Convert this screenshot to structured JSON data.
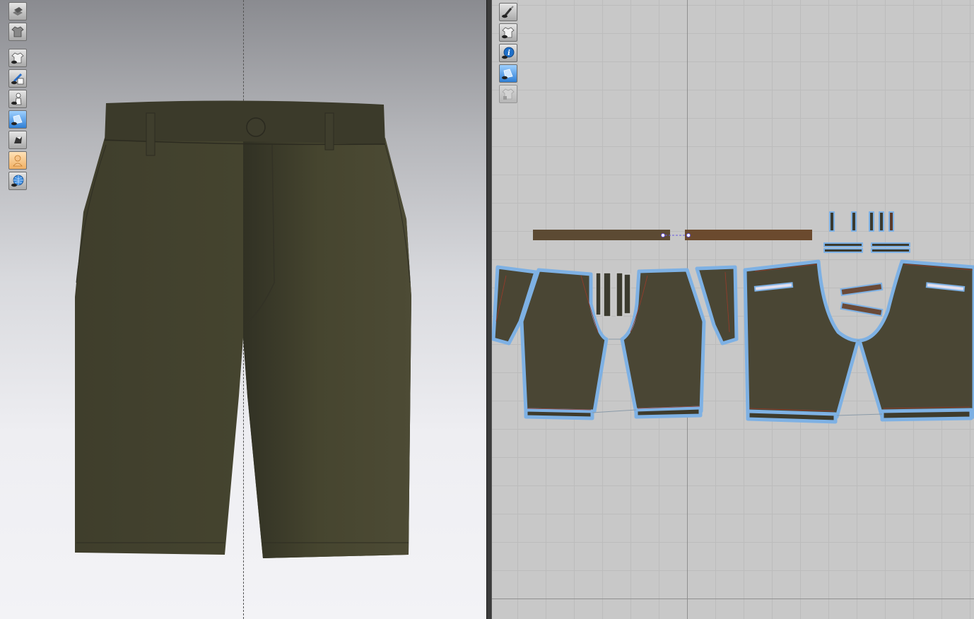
{
  "view3d": {
    "toolbar": [
      {
        "icon": "stack-icon"
      },
      {
        "icon": "garment-icon"
      },
      {
        "icon": "show-avatar-icon"
      },
      {
        "icon": "texture-icon"
      },
      {
        "icon": "avatar-figure-icon"
      },
      {
        "icon": "pieces-icon"
      },
      {
        "icon": "shape-icon"
      },
      {
        "icon": "skin-icon"
      },
      {
        "icon": "mesh-globe-icon"
      }
    ],
    "garment_color": "#44432f"
  },
  "view2d": {
    "toolbar": [
      {
        "icon": "brush-icon"
      },
      {
        "icon": "shirt-icon"
      },
      {
        "icon": "info-icon"
      },
      {
        "icon": "texture-icon"
      },
      {
        "icon": "lock-shirt-icon"
      }
    ],
    "piece_color": "#4a4634",
    "outline_color": "#7eb1e4",
    "waistband_color": "#6a4a30"
  }
}
